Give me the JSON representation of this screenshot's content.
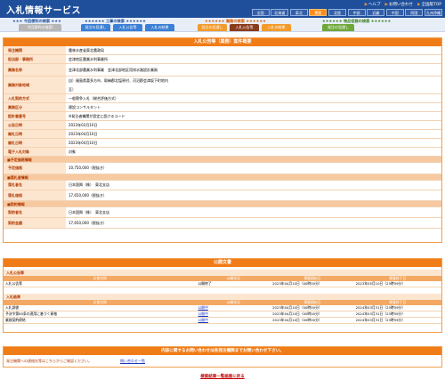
{
  "header": {
    "title": "入札情報サービス",
    "links": [
      "ヘルプ",
      "お問い合わせ",
      "全国版TOP"
    ],
    "regions": [
      "全国",
      "北海道",
      "東北",
      "関東",
      "北陸",
      "中部",
      "近畿",
      "中国",
      "四国",
      "九州沖縄"
    ],
    "active_region": 3
  },
  "search": {
    "groups": [
      "今回便利の検索",
      "工事の検索",
      "業務の検索",
      "物品役務の検索"
    ],
    "tabs": [
      "今回便利の検索Ⅰ",
      "発注の見通し",
      "入札公告等",
      "入札の結果",
      "発注の見通し",
      "入札公告等",
      "入札の結果",
      "発注の見通し"
    ]
  },
  "main": {
    "heading": "入札公告等（業務）案件概要",
    "rows": [
      {
        "label": "発注機関",
        "value": "農林水産省東北農政局"
      },
      {
        "label": "担当部・事務所",
        "value": "会津地区農業水利事業所"
      },
      {
        "label": "業務名称",
        "value": "会津北部農業水利事業　会津北部地区用排水路設計業務"
      },
      {
        "label": "業務対象地域",
        "value": "自）福島県喜多方市、耶麻郡北塩原村、河沼郡会津坂下町地内",
        "value2": "至）"
      },
      {
        "label": "入札契約方式",
        "value": "一般競争入札（総合評価方式）"
      },
      {
        "label": "業務区分",
        "value": "建設コンサルタント"
      },
      {
        "label": "設計書番号",
        "value": "※発注者機関が設定に設けるコード"
      },
      {
        "label": "公告日時",
        "value": "2023年02月10日"
      },
      {
        "label": "開札日時",
        "value": "2023年04月10日"
      },
      {
        "label": "開札日時",
        "value": "2023年04月10日"
      },
      {
        "label": "電子入札対象",
        "value": "対象"
      }
    ],
    "section_estimate": "■予定価格情報",
    "estimate_label": "予定価格",
    "estimate_value": "10,750,000（税抜き）",
    "section_award": "■落札者情報",
    "award_name_label": "落札者名",
    "award_name_value": "日本国興（株）　東北支店",
    "award_price_label": "落札価格",
    "award_price_value": "17,650,000（税抜き）",
    "section_contract": "■契約情報",
    "contract_name_label": "契約者名",
    "contract_name_value": "日本国興（株）　東北支店",
    "contract_price_label": "契約金額",
    "contract_price_value": "17,650,000（税抜き）"
  },
  "docs": {
    "heading": "公開文書",
    "section1": "入札公告等",
    "columns": [
      "文書名称",
      "公開状況",
      "掲載開始日",
      "掲載終了日"
    ],
    "rows1": [
      {
        "name": "入札公告等",
        "status": "公開終了",
        "start": "2023年04月10日（00時00分）",
        "end": "2023年05月10日（23時59分）"
      }
    ],
    "section2": "入札結果",
    "rows2": [
      {
        "name": "入札調書",
        "status": "公開中",
        "start": "2023年04月10日（00時00分）",
        "end": "2024年03月31日（23時59分）"
      },
      {
        "name": "予決令第85条の適用に基づく資格",
        "status": "公開中",
        "start": "2023年04月10日（00時00分）",
        "end": "2024年03月31日（23時59分）"
      },
      {
        "name": "業務契約締結",
        "status": "公開中",
        "start": "2023年04月10日（00時00分）",
        "end": "2024年03月31日（23時59分）"
      }
    ]
  },
  "contact": {
    "heading": "内容に関するお問い合わせは各発注機関までお問い合わせ下さい。",
    "text": "発注機関への連絡先等はこちらからご確認ください。",
    "link": "問い合わせ一覧"
  },
  "back_link": "検索結果一覧画面に戻る",
  "colors": {
    "primary": "#1f4f9a",
    "accent": "#f07c18"
  }
}
